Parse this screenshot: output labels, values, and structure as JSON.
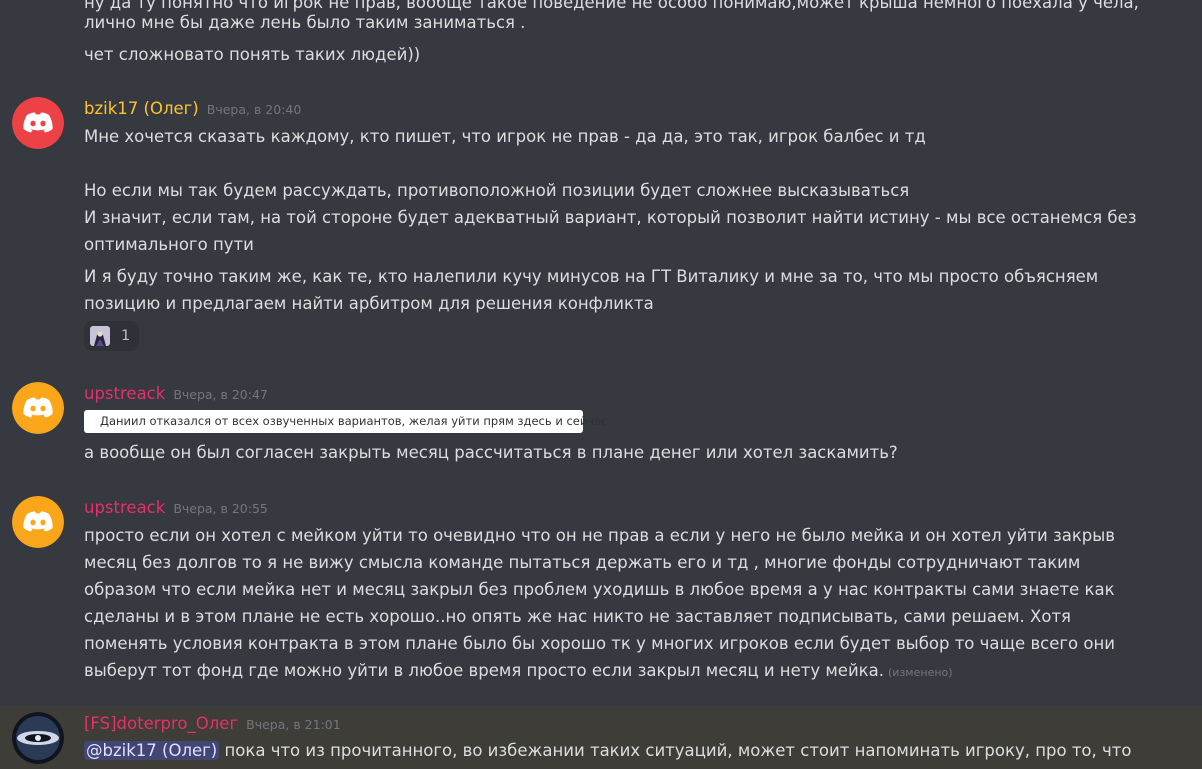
{
  "top_fragment": {
    "line0": "ну да ту понятно что игрок не прав, вообще такое поведение не особо понимаю,может крыша немного поехала у чела,",
    "line1": "лично мне бы даже лень было таким заниматься .",
    "line2": "чет сложновато понять таких людей))"
  },
  "messages": [
    {
      "username": "bzik17 (Олег)",
      "username_color": "#fdc42f",
      "avatar_color": "#ed4245",
      "timestamp": "Вчера, в 20:40",
      "lines": [
        "Мне хочется сказать каждому, кто пишет, что игрок не прав - да да, это так, игрок балбес и тд",
        "Но если мы так будем рассуждать, противоположной позиции будет сложнее высказываться",
        "И значит, если там, на той стороне будет адекватный вариант, который позволит найти истину - мы все останемся без",
        "оптимального пути",
        "И я буду точно таким же, как те, кто налепили кучу минусов на ГТ  Виталику и мне за то, что мы просто объясняем",
        "позицию и предлагаем найти арбитром для решения конфликта"
      ],
      "reaction": {
        "emoji": "custom-emoji",
        "count": "1"
      }
    },
    {
      "username": "upstreack",
      "username_color": "#e6306a",
      "avatar_color": "#faa61a",
      "timestamp": "Вчера, в 20:47",
      "embed_text": "Даниил отказался от всех озвученных вариантов, желая уйти прям здесь и сейчас.",
      "lines": [
        "а вообще он был согласен закрыть месяц рассчитаться в плане денег или хотел заскамить?"
      ]
    },
    {
      "username": "upstreack",
      "username_color": "#e6306a",
      "avatar_color": "#faa61a",
      "timestamp": "Вчера, в 20:55",
      "lines": [
        "просто если он хотел с мейком уйти то очевидно что он не прав а если  у него не было мейка и он хотел уйти закрыв",
        "месяц без долгов то я не вижу смысла команде пытаться держать его и тд , многие фонды сотрудничают таким",
        "образом что если мейка нет и месяц закрыл без проблем уходишь в любое время а у нас контракты сами знаете как",
        "сделаны и в этом плане не есть хорошо..но опять же нас никто не заставляет подписывать, сами решаем. Хотя",
        "поменять условия контракта в этом плане было бы хорошо тк у многих  игроков если будет выбор то чаще всего они",
        "выберут тот фонд где можно уйти в любое время просто если закрыл месяц и нету мейка."
      ],
      "edited_label": "(изменено)"
    },
    {
      "username": "[FS]doterpro_Олег",
      "username_color": "#e6306a",
      "timestamp": "Вчера, в 21:01",
      "mention": "@bzik17 (Олег)",
      "lines": [
        " пока что из прочитанного, во избежании таких ситуаций, может стоит напоминать игроку, про то, что"
      ]
    }
  ],
  "colors": {
    "background": "#36393f",
    "highlight_background": "#3e3d38",
    "text": "#dcddde",
    "timestamp": "#72767d",
    "mention_bg": "#414675"
  }
}
